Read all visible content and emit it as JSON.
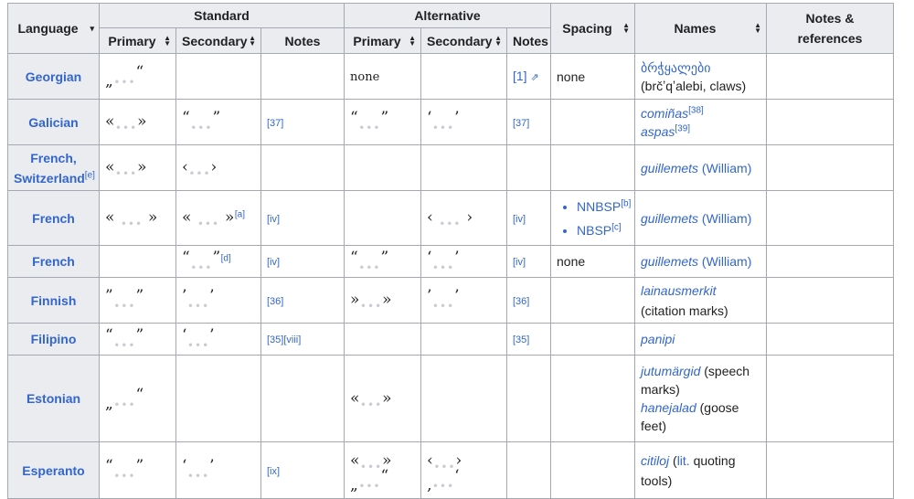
{
  "headers": {
    "language": "Language",
    "standard": "Standard",
    "alternative": "Alternative",
    "primary": "Primary",
    "secondary": "Secondary",
    "notes": "Notes",
    "spacing": "Spacing",
    "names": "Names",
    "notes_refs": "Notes & references"
  },
  "rows": [
    {
      "language": "Georgian",
      "std_primary": [
        "„",
        "“"
      ],
      "std_secondary": [],
      "std_notes": "",
      "alt_primary_text": "none",
      "alt_secondary": [],
      "alt_notes": "[1]",
      "spacing": "none",
      "names": [
        "ბრჭყალები",
        "(brčʼqʼalebi, claws)"
      ]
    },
    {
      "language": "Galician",
      "std_primary": [
        "«",
        "»"
      ],
      "std_secondary": [
        "“",
        "”"
      ],
      "std_notes": "[37]",
      "alt_primary": [
        "“",
        "”"
      ],
      "alt_secondary": [
        "‘",
        "’"
      ],
      "alt_notes": "[37]",
      "spacing": "",
      "names": [
        "comiñas",
        "[38]",
        "aspas",
        "[39]"
      ]
    },
    {
      "language": "French, Switzerland",
      "lang_ref": "[e]",
      "std_primary": [
        "«",
        "»"
      ],
      "std_secondary": [
        "‹",
        "›"
      ],
      "std_notes": "",
      "alt_primary": [],
      "alt_secondary": [],
      "alt_notes": "",
      "spacing": "",
      "names": [
        "guillemets",
        "(William)"
      ]
    },
    {
      "language": "French",
      "std_primary": [
        "«",
        "»"
      ],
      "std_secondary": [
        "«",
        "»"
      ],
      "std_secondary_ref": "[a]",
      "std_notes": "[iv]",
      "alt_primary": [],
      "alt_secondary": [
        "‹",
        "›"
      ],
      "alt_notes": "[iv]",
      "spacing": [
        "NNBSP",
        "[b]",
        "NBSP",
        "[c]"
      ],
      "names": [
        "guillemets",
        "(William)"
      ]
    },
    {
      "language": "French",
      "std_primary": [],
      "std_secondary": [
        "“",
        "”"
      ],
      "std_secondary_ref": "[d]",
      "std_notes": "[iv]",
      "alt_primary": [
        "“",
        "”"
      ],
      "alt_secondary": [
        "‘",
        "’"
      ],
      "alt_notes": "[iv]",
      "spacing": "none",
      "names": [
        "guillemets",
        "(William)"
      ]
    },
    {
      "language": "Finnish",
      "std_primary": [
        "”",
        "”"
      ],
      "std_secondary": [
        "’",
        "’"
      ],
      "std_notes": "[36]",
      "alt_primary": [
        "»",
        "»"
      ],
      "alt_secondary": [
        "’",
        "’"
      ],
      "alt_notes": "[36]",
      "spacing": "",
      "names": [
        "lainausmerkit",
        "(citation marks)"
      ]
    },
    {
      "language": "Filipino",
      "std_primary": [
        "“",
        "”"
      ],
      "std_secondary": [
        "‘",
        "’"
      ],
      "std_notes": "[35][viii]",
      "alt_primary": [],
      "alt_secondary": [],
      "alt_notes": "[35]",
      "spacing": "",
      "names": [
        "panipi"
      ]
    },
    {
      "language": "Estonian",
      "std_primary": [
        "„",
        "“"
      ],
      "std_secondary": [],
      "std_notes": "",
      "alt_primary": [
        "«",
        "»"
      ],
      "alt_secondary": [],
      "alt_notes": "",
      "spacing": "",
      "names": [
        "jutumärgid",
        "(speech marks)",
        "hanejalad",
        "(goose feet)"
      ]
    },
    {
      "language": "Esperanto",
      "std_primary": [
        "“",
        "”"
      ],
      "std_secondary": [
        "‘",
        "’"
      ],
      "std_notes": "[ix]",
      "alt_primary": [
        "«",
        "»",
        "„",
        "“"
      ],
      "alt_secondary": [
        "‹",
        "›",
        "‚",
        "‘"
      ],
      "alt_notes": "",
      "spacing": "",
      "names": [
        "citiloj",
        "(",
        "lit.",
        " quoting tools)"
      ]
    }
  ],
  "ellipsis": "•••",
  "sort_icon": "sort-updown-icon",
  "external_link_icon": "external-link-icon"
}
